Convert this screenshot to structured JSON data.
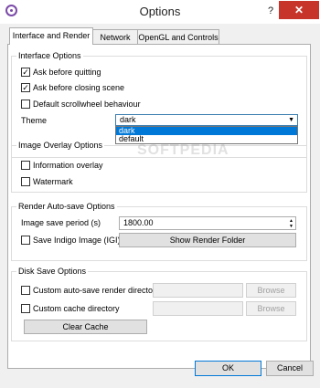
{
  "window": {
    "title": "Options",
    "help": "?",
    "close": "✕"
  },
  "tabs": [
    "Interface and Render",
    "Network",
    "OpenGL and Controls"
  ],
  "interface": {
    "title": "Interface Options",
    "ask_quit": "Ask before quitting",
    "ask_close": "Ask before closing scene",
    "scroll": "Default scrollwheel behaviour",
    "theme_label": "Theme",
    "theme_value": "dark",
    "theme_options": [
      "dark",
      "default"
    ]
  },
  "overlay": {
    "title": "Image Overlay Options",
    "info": "Information overlay",
    "watermark": "Watermark"
  },
  "autosave": {
    "title": "Render Auto-save Options",
    "period_label": "Image save period (s)",
    "period_value": "1800.00",
    "save_igi": "Save Indigo Image (IGI)",
    "show_folder": "Show Render Folder"
  },
  "disk": {
    "title": "Disk Save Options",
    "custom_render": "Custom auto-save render directory",
    "custom_cache": "Custom cache directory",
    "browse": "Browse",
    "clear_cache": "Clear Cache"
  },
  "footer": {
    "ok": "OK",
    "cancel": "Cancel"
  },
  "watermark_text": "SOFTPEDIA"
}
